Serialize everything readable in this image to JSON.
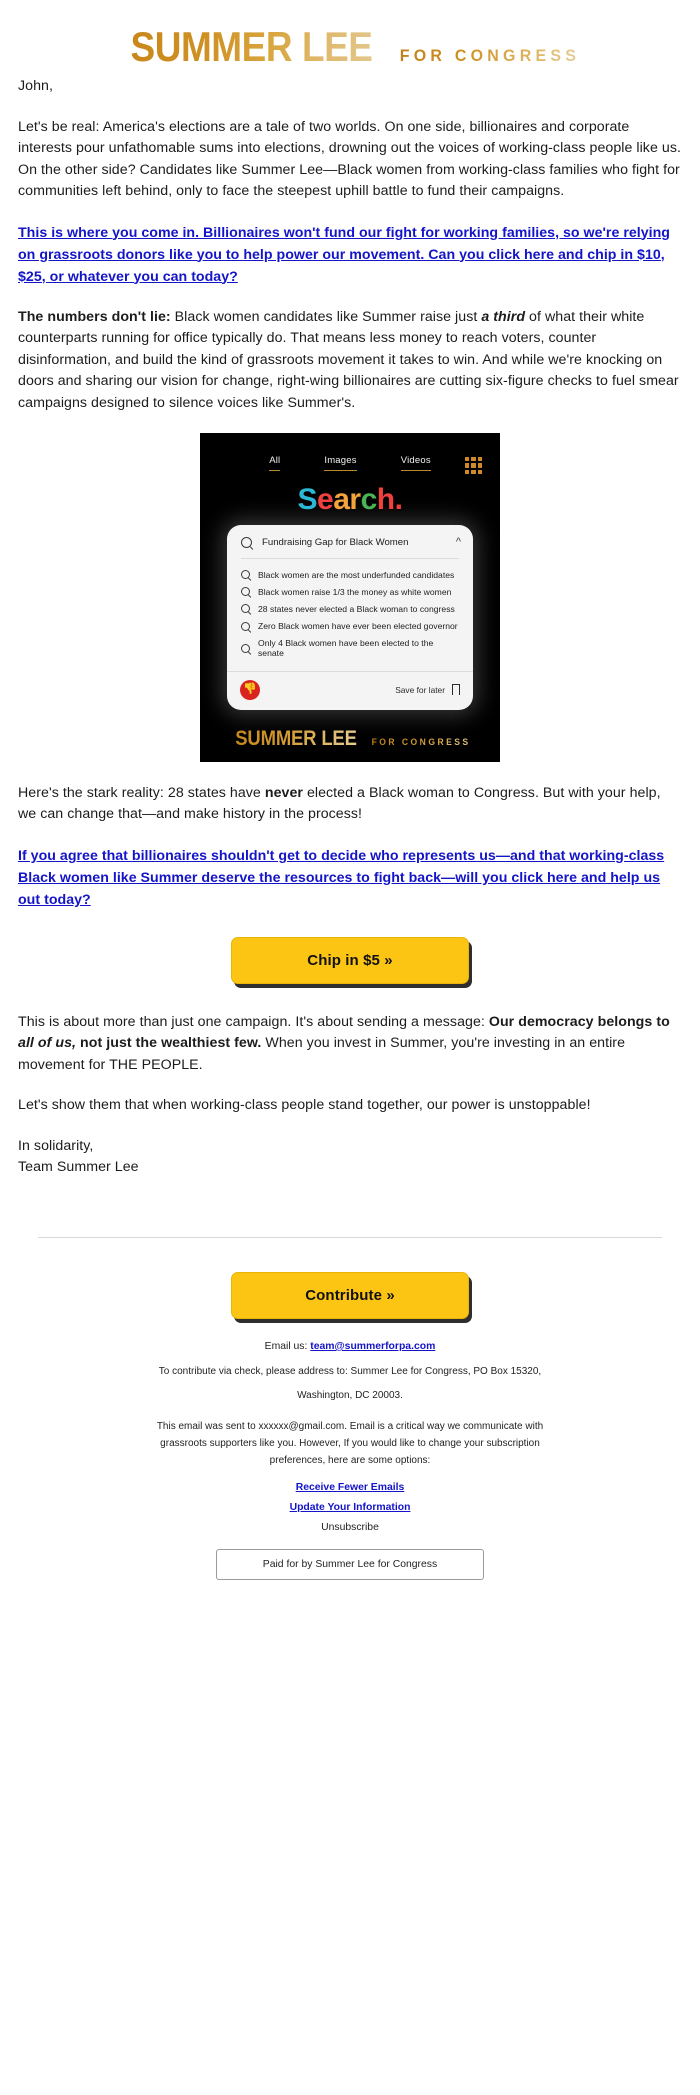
{
  "logo": {
    "main": "SUMMER LEE",
    "sub": "FOR CONGRESS"
  },
  "email": {
    "greeting": "John,",
    "para1_a": "Let's be real: America's elections are a tale of two worlds. On one side, billionaires and corporate interests pour unfathomable sums into elections, drowning out the voices of working-class people like us. On the other side? Candidates like Summer Lee—Black women from working-class families who fight for communities left behind, only to face the steepest uphill battle to fund their campaigns.",
    "cta1": "This is where you come in. Billionaires won't fund our fight for working families, so we're relying on grassroots donors like you to help power our movement. Can you click here and chip in $10, $25, or whatever you can today?",
    "para2_bold": "The numbers don't lie:",
    "para2_b": " Black women candidates like Summer raise just ",
    "para2_emph": "a third",
    "para2_c": " of what their white counterparts running for office typically do. That means less money to reach voters, counter disinformation, and build the kind of grassroots movement it takes to win. And while we're knocking on doors and sharing our vision for change, right-wing billionaires are cutting six-figure checks to fuel smear campaigns designed to silence voices like Summer's.",
    "para3_a": "Here's the stark reality: 28 states have ",
    "para3_never": "never",
    "para3_b": " elected a Black woman to Congress. But with your help, we can change that—and make history in the process!",
    "cta2": "If you agree that billionaires shouldn't get to decide who represents us—and that working-class Black women like Summer deserve the resources to fight back—will you click here and help us out today?",
    "chip_button": "Chip in $5 »",
    "para4_a": "This is about more than just one campaign. It's about sending a message: ",
    "para4_bold1": "Our democracy belongs to ",
    "para4_bolditalic": "all of us,",
    "para4_bold2": " not just the wealthiest few.",
    "para4_b": " When you invest in Summer, you're investing in an entire movement for THE PEOPLE.",
    "para5": "Let's show them that when working-class people stand together, our power is unstoppable!",
    "signoff1": "In solidarity,",
    "signoff2": "Team Summer Lee"
  },
  "graphic": {
    "tabs": [
      "All",
      "Images",
      "Videos"
    ],
    "grid_icon": "apps-grid-icon",
    "title_letters": [
      {
        "ch": "S",
        "color": "#2bb8d6"
      },
      {
        "ch": "e",
        "color": "#f0413f"
      },
      {
        "ch": "a",
        "color": "#f3a23c"
      },
      {
        "ch": "r",
        "color": "#f3a23c"
      },
      {
        "ch": "c",
        "color": "#49b356"
      },
      {
        "ch": "h",
        "color": "#f0413f"
      },
      {
        "ch": ".",
        "color": "#f0413f"
      }
    ],
    "query": "Fundraising Gap for Black Women",
    "suggestions": [
      "Black women are the most underfunded candidates",
      "Black women raise 1/3 the money as white women",
      "28 states never elected a Black woman to congress",
      "Zero Black women have ever been elected governor",
      "Only 4 Black women have been elected to the senate"
    ],
    "save_label": "Save for later",
    "thumbs_down": "👎",
    "logo_main": "SUMMER LEE",
    "logo_sub": "FOR CONGRESS"
  },
  "footer": {
    "contribute_button": "Contribute »",
    "email_label": "Email us: ",
    "email_address": "team@summerforpa.com",
    "check_line1": "To contribute via check, please address to: Summer Lee for Congress, PO Box 15320,",
    "check_line2": "Washington, DC 20003.",
    "disclaimer1": "This email was sent to xxxxxx@gmail.com. Email is a critical way we communicate with",
    "disclaimer2": "grassroots supporters like you. However, If you would like to change your subscription",
    "disclaimer3": "preferences, here are some options:",
    "link_fewer": "Receive Fewer Emails",
    "link_update": "Update Your Information",
    "link_unsub": "Unsubscribe",
    "paid_for": "Paid for by Summer Lee for Congress"
  },
  "colors": {
    "gold": "#d09a2e",
    "button": "#fdc513",
    "link_blue": "#1414c8"
  }
}
